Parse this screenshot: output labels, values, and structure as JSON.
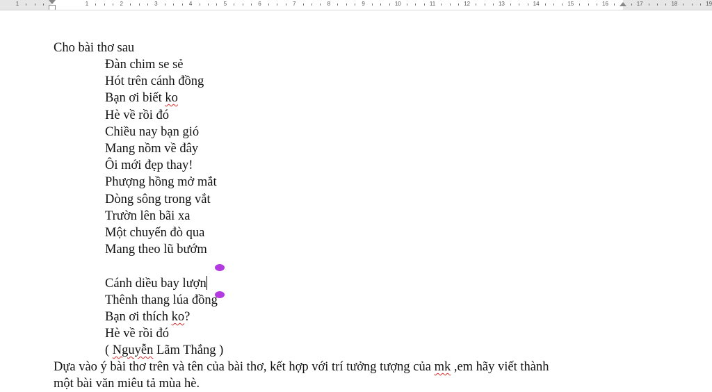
{
  "ruler": {
    "numbers": [
      "1",
      "1",
      "2",
      "3",
      "4",
      "5",
      "6",
      "7",
      "8",
      "9",
      "10",
      "11",
      "12",
      "13",
      "14",
      "15",
      "16",
      "17",
      "18",
      "19"
    ]
  },
  "document": {
    "intro": "Cho bài thơ sau",
    "poem": [
      {
        "text": "Đàn chim se sẻ"
      },
      {
        "text": "Hót trên cánh đồng"
      },
      {
        "pre": " Bạn ơi biết ",
        "err": "ko",
        "post": ""
      },
      {
        "text": "Hè về rồi đó"
      },
      {
        "text": "Chiều nay bạn gió"
      },
      {
        "text": "Mang nồm về đây"
      },
      {
        "text": "Ôi mới đẹp thay!"
      },
      {
        "text": "Phượng hồng mở mắt"
      },
      {
        "text": "Dòng sông trong vắt"
      },
      {
        "text": "Trườn lên bãi xa"
      },
      {
        "text": "Một chuyến đò qua"
      },
      {
        "text": "Mang theo lũ bướm"
      },
      {
        "text": ""
      },
      {
        "text": "Cánh diều bay lượn",
        "cursor": true
      },
      {
        "text": "Thênh thang lúa đồng"
      },
      {
        "pre": "Bạn ơi thích ",
        "err": "ko",
        "post": "?"
      },
      {
        "text": "Hè về rồi đó"
      },
      {
        "pre": "( ",
        "err": "Nguyễn",
        "post": " Lãm Thắng )"
      }
    ],
    "prompt": [
      {
        "pre": "Dựa vào ý bài thơ trên và tên của bài thơ, kết hợp với trí tưởng tượng của ",
        "err": "mk",
        "post": " ,em hãy viết thành"
      },
      {
        "text": "một bài văn miêu tả mùa hè."
      }
    ]
  },
  "colors": {
    "selection_handle": "#b23ae0",
    "spell_error": "#d62b2b"
  }
}
